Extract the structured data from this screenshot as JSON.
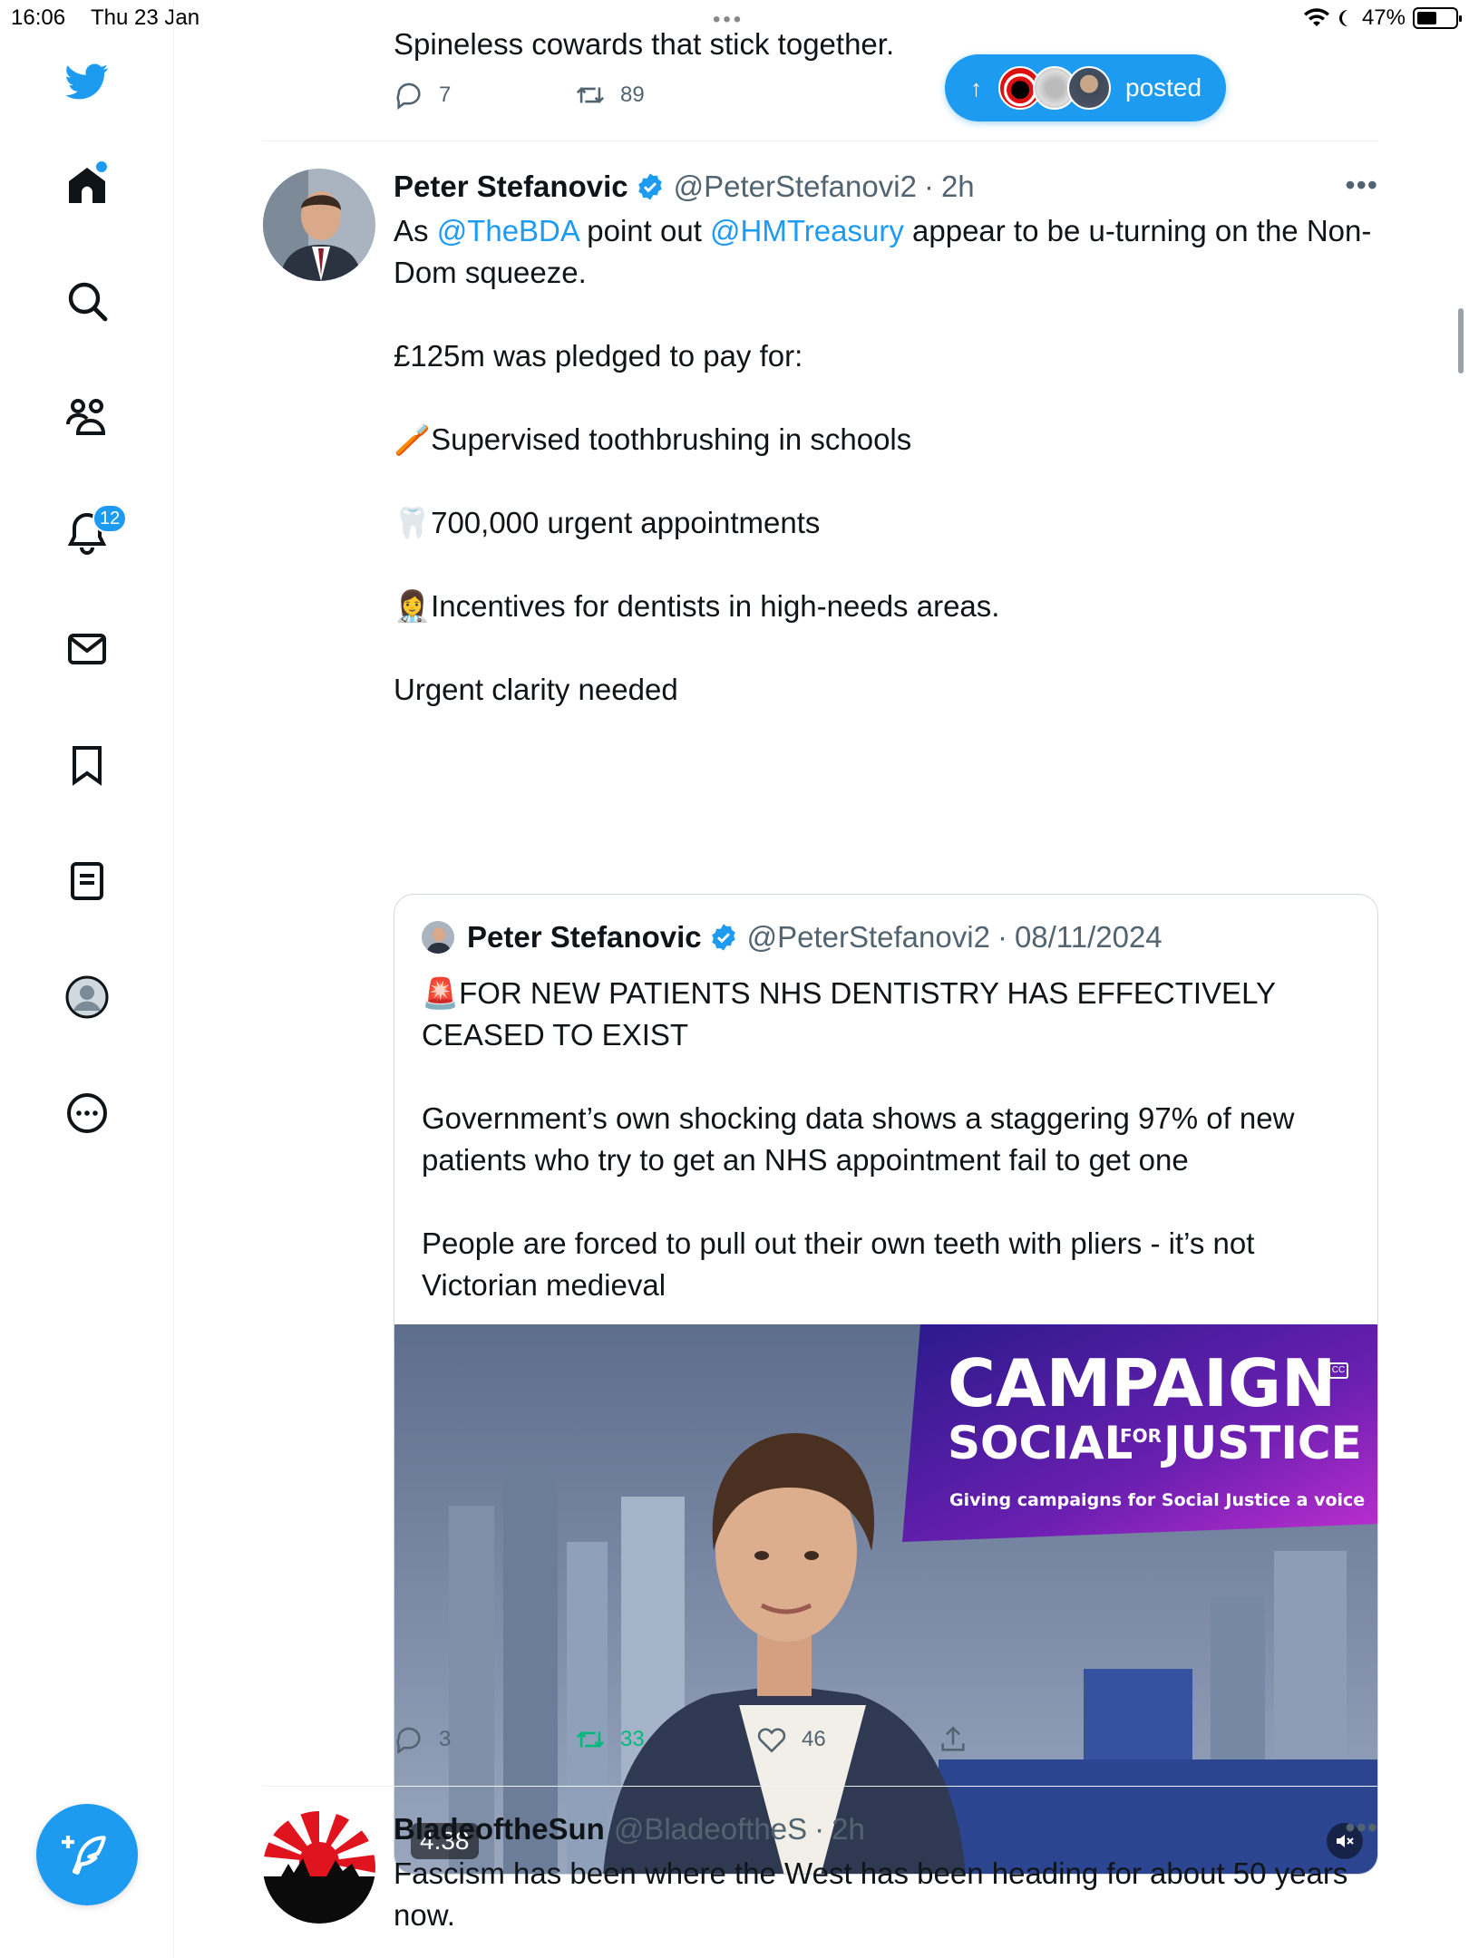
{
  "status_bar": {
    "time": "16:06",
    "date": "Thu 23 Jan",
    "battery": "47%"
  },
  "sidebar": {
    "items": [
      {
        "name": "twitter-logo"
      },
      {
        "name": "home"
      },
      {
        "name": "search"
      },
      {
        "name": "communities"
      },
      {
        "name": "notifications",
        "badge": "12"
      },
      {
        "name": "messages"
      },
      {
        "name": "bookmarks"
      },
      {
        "name": "lists"
      },
      {
        "name": "profile"
      },
      {
        "name": "more"
      }
    ]
  },
  "posted_pill": {
    "label": "posted"
  },
  "previous_tweet": {
    "text": "Spineless cowards that stick together.",
    "replies": "7",
    "retweets": "89"
  },
  "tweet": {
    "name": "Peter Stefanovic",
    "handle": "@PeterStefanovi2",
    "time": "2h",
    "text_prefix": "As ",
    "mention1": "@TheBDA",
    "text_mid": " point out ",
    "mention2": "@HMTreasury",
    "text_rest": " appear to be u-turning on the Non-Dom squeeze.",
    "body": "£125m was pledged to pay for:\n\n🪥Supervised toothbrushing in schools\n\n🦷700,000 urgent appointments\n\n👩‍⚕️Incentives for dentists in high-needs areas.\n\nUrgent clarity needed",
    "replies": "3",
    "retweets": "33",
    "likes": "46"
  },
  "quoted_tweet": {
    "name": "Peter Stefanovic",
    "handle": "@PeterStefanovi2",
    "date": "08/11/2024",
    "text": "🚨FOR NEW PATIENTS NHS DENTISTRY HAS EFFECTIVELY CEASED TO EXIST\n\nGovernment’s own shocking data shows a staggering 97% of new patients who try to get an NHS appointment fail to get one\n\nPeople are forced to pull out their own teeth with pliers - it’s not Victorian medieval",
    "video": {
      "duration": "4:38",
      "banner_line1": "CAMPAIGN",
      "banner_line2a": "SOCIAL",
      "banner_for": "FOR",
      "banner_line2b": "JUSTICE",
      "banner_tagline": "Giving campaigns for Social Justice a voice"
    }
  },
  "next_tweet": {
    "name": "BladeoftheSun",
    "handle": "@BladeoftheS",
    "time": "2h",
    "text": "Fascism has been where the West has been heading for about 50 years now."
  },
  "colors": {
    "accent": "#1d9bf0",
    "text": "#0f1419",
    "secondary": "#536471",
    "retweet_active": "#00ba7c"
  }
}
